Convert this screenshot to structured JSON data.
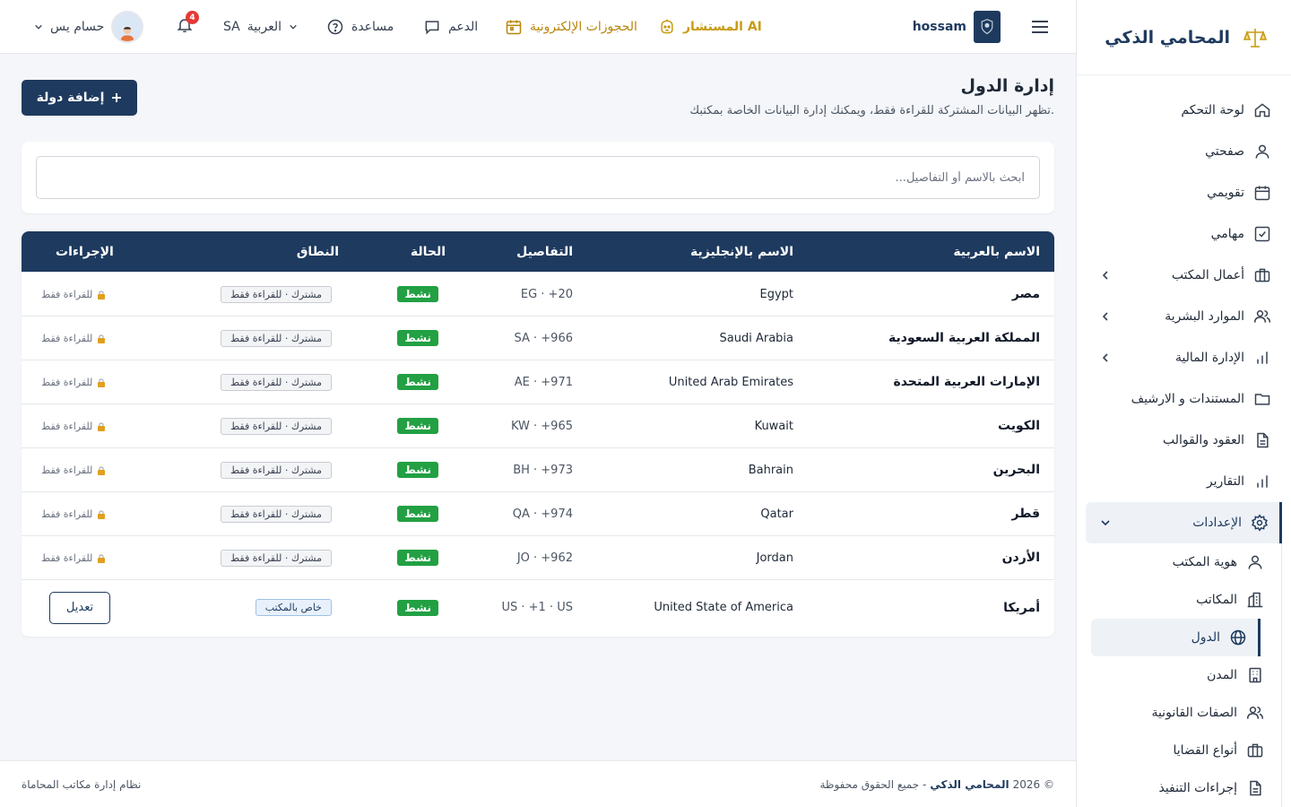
{
  "sidebar": {
    "brand": "المحامي الذكي",
    "items": [
      {
        "label": "لوحة التحكم",
        "icon": "home-icon"
      },
      {
        "label": "صفحتي",
        "icon": "user-icon"
      },
      {
        "label": "تقويمي",
        "icon": "calendar-icon"
      },
      {
        "label": "مهامي",
        "icon": "check-square-icon"
      },
      {
        "label": "أعمال المكتب",
        "icon": "briefcase-icon"
      },
      {
        "label": "الموارد البشرية",
        "icon": "users-icon"
      },
      {
        "label": "الإدارة المالية",
        "icon": "bar-chart-icon"
      },
      {
        "label": "المستندات و الارشيف",
        "icon": "folder-icon"
      },
      {
        "label": "العقود والقوالب",
        "icon": "file-text-icon"
      },
      {
        "label": "التقارير",
        "icon": "bar-chart-icon"
      },
      {
        "label": "الإعدادات",
        "icon": "gear-icon"
      }
    ],
    "settings_sub": [
      {
        "label": "هوية المكتب",
        "icon": "user-icon"
      },
      {
        "label": "المكاتب",
        "icon": "building-icon"
      },
      {
        "label": "الدول",
        "icon": "globe-icon"
      },
      {
        "label": "المدن",
        "icon": "office-building-icon"
      },
      {
        "label": "الصفات القانونية",
        "icon": "users-icon"
      },
      {
        "label": "أنواع القضايا",
        "icon": "briefcase-icon"
      },
      {
        "label": "إجراءات التنفيذ",
        "icon": "file-text-icon"
      }
    ]
  },
  "topbar": {
    "user_name": "hossam",
    "ai_label": "المستشار AI",
    "bookings_label": "الحجوزات الإلكترونية",
    "support_label": "الدعم",
    "help_label": "مساعدة",
    "lang_code": "SA",
    "lang_label": "العربية",
    "notifications_count": "4",
    "profile_name": "حسام يس"
  },
  "page": {
    "title": "إدارة الدول",
    "subtitle": "تظهر البيانات المشتركة للقراءة فقط، ويمكنك إدارة البيانات الخاصة بمكتبك.",
    "add_button": "إضافة دولة",
    "search_placeholder": "ابحث بالاسم أو التفاصيل..."
  },
  "table": {
    "headers": {
      "name_ar": "الاسم بالعربية",
      "name_en": "الاسم بالإنجليزية",
      "details": "التفاصيل",
      "status": "الحالة",
      "scope": "النطاق",
      "actions": "الإجراءات"
    },
    "rows": [
      {
        "name_ar": "مصر",
        "name_en": "Egypt",
        "details": "EG · +20",
        "status": "نشط",
        "scope": "مشترك · للقراءة فقط",
        "action": "للقراءة فقط"
      },
      {
        "name_ar": "المملكة العربية السعودية",
        "name_en": "Saudi Arabia",
        "details": "SA · +966",
        "status": "نشط",
        "scope": "مشترك · للقراءة فقط",
        "action": "للقراءة فقط"
      },
      {
        "name_ar": "الإمارات العربية المتحدة",
        "name_en": "United Arab Emirates",
        "details": "AE · +971",
        "status": "نشط",
        "scope": "مشترك · للقراءة فقط",
        "action": "للقراءة فقط"
      },
      {
        "name_ar": "الكويت",
        "name_en": "Kuwait",
        "details": "KW · +965",
        "status": "نشط",
        "scope": "مشترك · للقراءة فقط",
        "action": "للقراءة فقط"
      },
      {
        "name_ar": "البحرين",
        "name_en": "Bahrain",
        "details": "BH · +973",
        "status": "نشط",
        "scope": "مشترك · للقراءة فقط",
        "action": "للقراءة فقط"
      },
      {
        "name_ar": "قطر",
        "name_en": "Qatar",
        "details": "QA · +974",
        "status": "نشط",
        "scope": "مشترك · للقراءة فقط",
        "action": "للقراءة فقط"
      },
      {
        "name_ar": "الأردن",
        "name_en": "Jordan",
        "details": "JO · +962",
        "status": "نشط",
        "scope": "مشترك · للقراءة فقط",
        "action": "للقراءة فقط"
      },
      {
        "name_ar": "أمريكا",
        "name_en": "United State of America",
        "details": "US · +1 · US",
        "status": "نشط",
        "scope": "خاص بالمكتب",
        "action": "تعديل"
      }
    ]
  },
  "footer": {
    "copyright_prefix": "© 2026",
    "brand": "المحامي الذكي",
    "rights": "- جميع الحقوق محفوظة",
    "system": "نظام إدارة مكاتب المحاماة"
  },
  "colors": {
    "primary": "#1e3a5f",
    "active_status": "#22a043",
    "ai_gold": "#c89b14",
    "badge": "#e53935"
  }
}
